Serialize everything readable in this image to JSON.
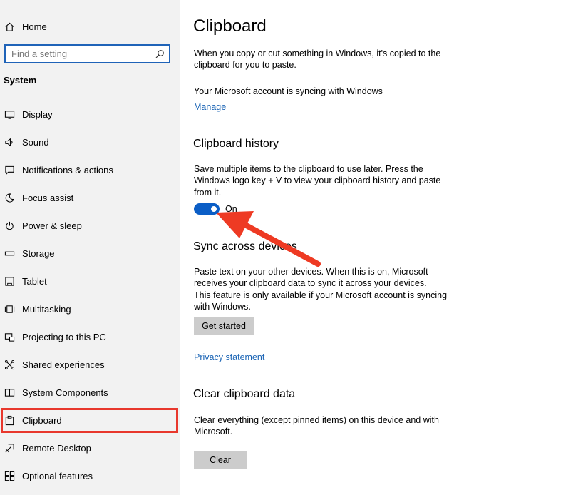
{
  "sidebar": {
    "home_label": "Home",
    "search_placeholder": "Find a setting",
    "section_heading": "System",
    "items": [
      {
        "label": "Display",
        "icon": "monitor-icon"
      },
      {
        "label": "Sound",
        "icon": "speaker-icon"
      },
      {
        "label": "Notifications & actions",
        "icon": "notification-icon"
      },
      {
        "label": "Focus assist",
        "icon": "moon-icon"
      },
      {
        "label": "Power & sleep",
        "icon": "power-icon"
      },
      {
        "label": "Storage",
        "icon": "storage-icon"
      },
      {
        "label": "Tablet",
        "icon": "tablet-icon"
      },
      {
        "label": "Multitasking",
        "icon": "multitasking-icon"
      },
      {
        "label": "Projecting to this PC",
        "icon": "projecting-icon"
      },
      {
        "label": "Shared experiences",
        "icon": "shared-icon"
      },
      {
        "label": "System Components",
        "icon": "components-icon"
      },
      {
        "label": "Clipboard",
        "icon": "clipboard-icon"
      },
      {
        "label": "Remote Desktop",
        "icon": "remote-desktop-icon"
      },
      {
        "label": "Optional features",
        "icon": "features-icon"
      }
    ],
    "selected": "Clipboard"
  },
  "main": {
    "title": "Clipboard",
    "intro": "When you copy or cut something in Windows, it's copied to the clipboard for you to paste.",
    "sync_status": "Your Microsoft account is syncing with Windows",
    "manage_link": "Manage",
    "history": {
      "title": "Clipboard history",
      "description": "Save multiple items to the clipboard to use later. Press the Windows logo key + V to view your clipboard history and paste from it.",
      "toggle_state": "On"
    },
    "sync": {
      "title": "Sync across devices",
      "description1": "Paste text on your other devices. When this is on, Microsoft receives your clipboard data to sync it across your devices.",
      "description2": "This feature is only available if your Microsoft account is syncing with Windows.",
      "button": "Get started",
      "privacy_link": "Privacy statement"
    },
    "clear": {
      "title": "Clear clipboard data",
      "description": "Clear everything (except pinned items) on this device and with Microsoft.",
      "button": "Clear"
    }
  },
  "colors": {
    "accent": "#0b5ec6",
    "link": "#1a64b5",
    "highlight": "#e8382d",
    "sidebar_bg": "#f2f2f2"
  }
}
